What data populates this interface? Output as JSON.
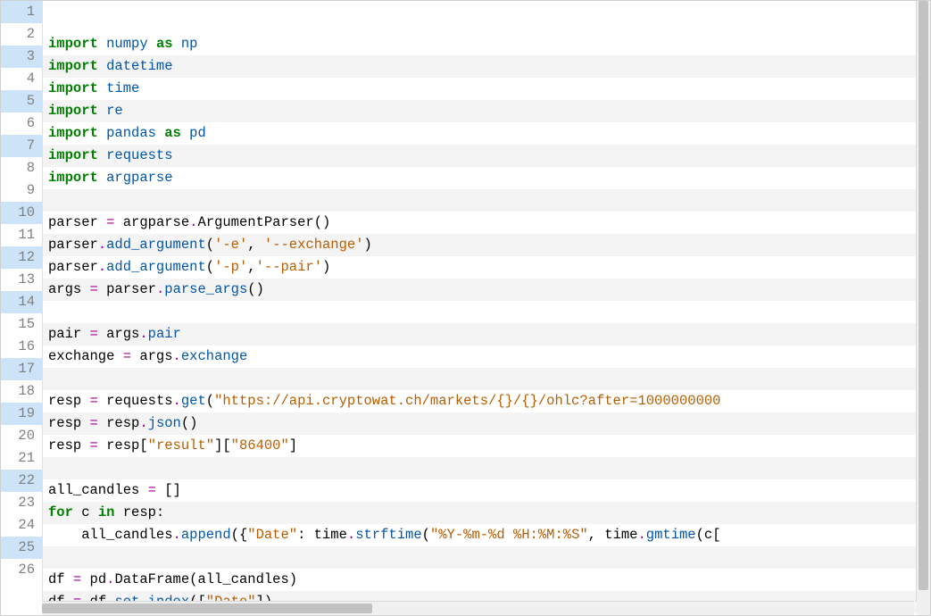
{
  "editor": {
    "highlighted_lines": [
      1,
      3,
      5,
      7,
      10,
      12,
      14,
      17,
      19,
      22,
      25
    ],
    "stripe_lines": [
      2,
      4,
      6,
      8,
      10,
      12,
      14,
      16,
      18,
      20,
      22,
      24,
      26
    ],
    "lines": [
      {
        "n": 1,
        "tokens": [
          {
            "t": "import",
            "c": "kw"
          },
          {
            "t": " ",
            "c": "nm"
          },
          {
            "t": "numpy",
            "c": "fn"
          },
          {
            "t": " ",
            "c": "nm"
          },
          {
            "t": "as",
            "c": "kw"
          },
          {
            "t": " ",
            "c": "nm"
          },
          {
            "t": "np",
            "c": "fn"
          }
        ]
      },
      {
        "n": 2,
        "tokens": [
          {
            "t": "import",
            "c": "kw"
          },
          {
            "t": " ",
            "c": "nm"
          },
          {
            "t": "datetime",
            "c": "fn"
          }
        ]
      },
      {
        "n": 3,
        "tokens": [
          {
            "t": "import",
            "c": "kw"
          },
          {
            "t": " ",
            "c": "nm"
          },
          {
            "t": "time",
            "c": "fn"
          }
        ]
      },
      {
        "n": 4,
        "tokens": [
          {
            "t": "import",
            "c": "kw"
          },
          {
            "t": " ",
            "c": "nm"
          },
          {
            "t": "re",
            "c": "fn"
          }
        ]
      },
      {
        "n": 5,
        "tokens": [
          {
            "t": "import",
            "c": "kw"
          },
          {
            "t": " ",
            "c": "nm"
          },
          {
            "t": "pandas",
            "c": "fn"
          },
          {
            "t": " ",
            "c": "nm"
          },
          {
            "t": "as",
            "c": "kw"
          },
          {
            "t": " ",
            "c": "nm"
          },
          {
            "t": "pd",
            "c": "fn"
          }
        ]
      },
      {
        "n": 6,
        "tokens": [
          {
            "t": "import",
            "c": "kw"
          },
          {
            "t": " ",
            "c": "nm"
          },
          {
            "t": "requests",
            "c": "fn"
          }
        ]
      },
      {
        "n": 7,
        "tokens": [
          {
            "t": "import",
            "c": "kw"
          },
          {
            "t": " ",
            "c": "nm"
          },
          {
            "t": "argparse",
            "c": "fn"
          }
        ]
      },
      {
        "n": 8,
        "tokens": []
      },
      {
        "n": 9,
        "tokens": [
          {
            "t": "parser ",
            "c": "nm"
          },
          {
            "t": "=",
            "c": "op"
          },
          {
            "t": " argparse",
            "c": "nm"
          },
          {
            "t": ".",
            "c": "op"
          },
          {
            "t": "ArgumentParser",
            "c": "nm"
          },
          {
            "t": "()",
            "c": "punct"
          }
        ]
      },
      {
        "n": 10,
        "tokens": [
          {
            "t": "parser",
            "c": "nm"
          },
          {
            "t": ".",
            "c": "op"
          },
          {
            "t": "add_argument",
            "c": "fn"
          },
          {
            "t": "(",
            "c": "punct"
          },
          {
            "t": "'-e'",
            "c": "str"
          },
          {
            "t": ", ",
            "c": "punct"
          },
          {
            "t": "'--exchange'",
            "c": "str"
          },
          {
            "t": ")",
            "c": "punct"
          }
        ]
      },
      {
        "n": 11,
        "tokens": [
          {
            "t": "parser",
            "c": "nm"
          },
          {
            "t": ".",
            "c": "op"
          },
          {
            "t": "add_argument",
            "c": "fn"
          },
          {
            "t": "(",
            "c": "punct"
          },
          {
            "t": "'-p'",
            "c": "str"
          },
          {
            "t": ",",
            "c": "punct"
          },
          {
            "t": "'--pair'",
            "c": "str"
          },
          {
            "t": ")",
            "c": "punct"
          }
        ]
      },
      {
        "n": 12,
        "tokens": [
          {
            "t": "args ",
            "c": "nm"
          },
          {
            "t": "=",
            "c": "op"
          },
          {
            "t": " parser",
            "c": "nm"
          },
          {
            "t": ".",
            "c": "op"
          },
          {
            "t": "parse_args",
            "c": "fn"
          },
          {
            "t": "()",
            "c": "punct"
          }
        ]
      },
      {
        "n": 13,
        "tokens": []
      },
      {
        "n": 14,
        "tokens": [
          {
            "t": "pair ",
            "c": "nm"
          },
          {
            "t": "=",
            "c": "op"
          },
          {
            "t": " args",
            "c": "nm"
          },
          {
            "t": ".",
            "c": "op"
          },
          {
            "t": "pair",
            "c": "fn"
          }
        ]
      },
      {
        "n": 15,
        "tokens": [
          {
            "t": "exchange ",
            "c": "nm"
          },
          {
            "t": "=",
            "c": "op"
          },
          {
            "t": " args",
            "c": "nm"
          },
          {
            "t": ".",
            "c": "op"
          },
          {
            "t": "exchange",
            "c": "fn"
          }
        ]
      },
      {
        "n": 16,
        "tokens": []
      },
      {
        "n": 17,
        "tokens": [
          {
            "t": "resp ",
            "c": "nm"
          },
          {
            "t": "=",
            "c": "op"
          },
          {
            "t": " requests",
            "c": "nm"
          },
          {
            "t": ".",
            "c": "op"
          },
          {
            "t": "get",
            "c": "fn"
          },
          {
            "t": "(",
            "c": "punct"
          },
          {
            "t": "\"https://api.cryptowat.ch/markets/{}/{}/ohlc?after=1000000000",
            "c": "str"
          }
        ]
      },
      {
        "n": 18,
        "tokens": [
          {
            "t": "resp ",
            "c": "nm"
          },
          {
            "t": "=",
            "c": "op"
          },
          {
            "t": " resp",
            "c": "nm"
          },
          {
            "t": ".",
            "c": "op"
          },
          {
            "t": "json",
            "c": "fn"
          },
          {
            "t": "()",
            "c": "punct"
          }
        ]
      },
      {
        "n": 19,
        "tokens": [
          {
            "t": "resp ",
            "c": "nm"
          },
          {
            "t": "=",
            "c": "op"
          },
          {
            "t": " resp[",
            "c": "nm"
          },
          {
            "t": "\"result\"",
            "c": "str"
          },
          {
            "t": "][",
            "c": "nm"
          },
          {
            "t": "\"86400\"",
            "c": "str"
          },
          {
            "t": "]",
            "c": "nm"
          }
        ]
      },
      {
        "n": 20,
        "tokens": []
      },
      {
        "n": 21,
        "tokens": [
          {
            "t": "all_candles ",
            "c": "nm"
          },
          {
            "t": "=",
            "c": "op"
          },
          {
            "t": " []",
            "c": "nm"
          }
        ]
      },
      {
        "n": 22,
        "tokens": [
          {
            "t": "for",
            "c": "kw"
          },
          {
            "t": " c ",
            "c": "nm"
          },
          {
            "t": "in",
            "c": "kw"
          },
          {
            "t": " resp:",
            "c": "nm"
          }
        ]
      },
      {
        "n": 23,
        "tokens": [
          {
            "t": "    all_candles",
            "c": "nm"
          },
          {
            "t": ".",
            "c": "op"
          },
          {
            "t": "append",
            "c": "fn"
          },
          {
            "t": "({",
            "c": "punct"
          },
          {
            "t": "\"Date\"",
            "c": "str"
          },
          {
            "t": ": time",
            "c": "nm"
          },
          {
            "t": ".",
            "c": "op"
          },
          {
            "t": "strftime",
            "c": "fn"
          },
          {
            "t": "(",
            "c": "punct"
          },
          {
            "t": "\"%Y-%m-%d %H:%M:%S\"",
            "c": "str"
          },
          {
            "t": ", time",
            "c": "nm"
          },
          {
            "t": ".",
            "c": "op"
          },
          {
            "t": "gmtime",
            "c": "fn"
          },
          {
            "t": "(c[",
            "c": "nm"
          }
        ]
      },
      {
        "n": 24,
        "tokens": []
      },
      {
        "n": 25,
        "tokens": [
          {
            "t": "df ",
            "c": "nm"
          },
          {
            "t": "=",
            "c": "op"
          },
          {
            "t": " pd",
            "c": "nm"
          },
          {
            "t": ".",
            "c": "op"
          },
          {
            "t": "DataFrame",
            "c": "nm"
          },
          {
            "t": "(all_candles)",
            "c": "nm"
          }
        ]
      },
      {
        "n": 26,
        "tokens": [
          {
            "t": "df ",
            "c": "nm"
          },
          {
            "t": "=",
            "c": "op"
          },
          {
            "t": " df",
            "c": "nm"
          },
          {
            "t": ".",
            "c": "op"
          },
          {
            "t": "set_index",
            "c": "fn"
          },
          {
            "t": "([",
            "c": "punct"
          },
          {
            "t": "\"Date\"",
            "c": "str"
          },
          {
            "t": "])",
            "c": "punct"
          }
        ]
      }
    ]
  }
}
